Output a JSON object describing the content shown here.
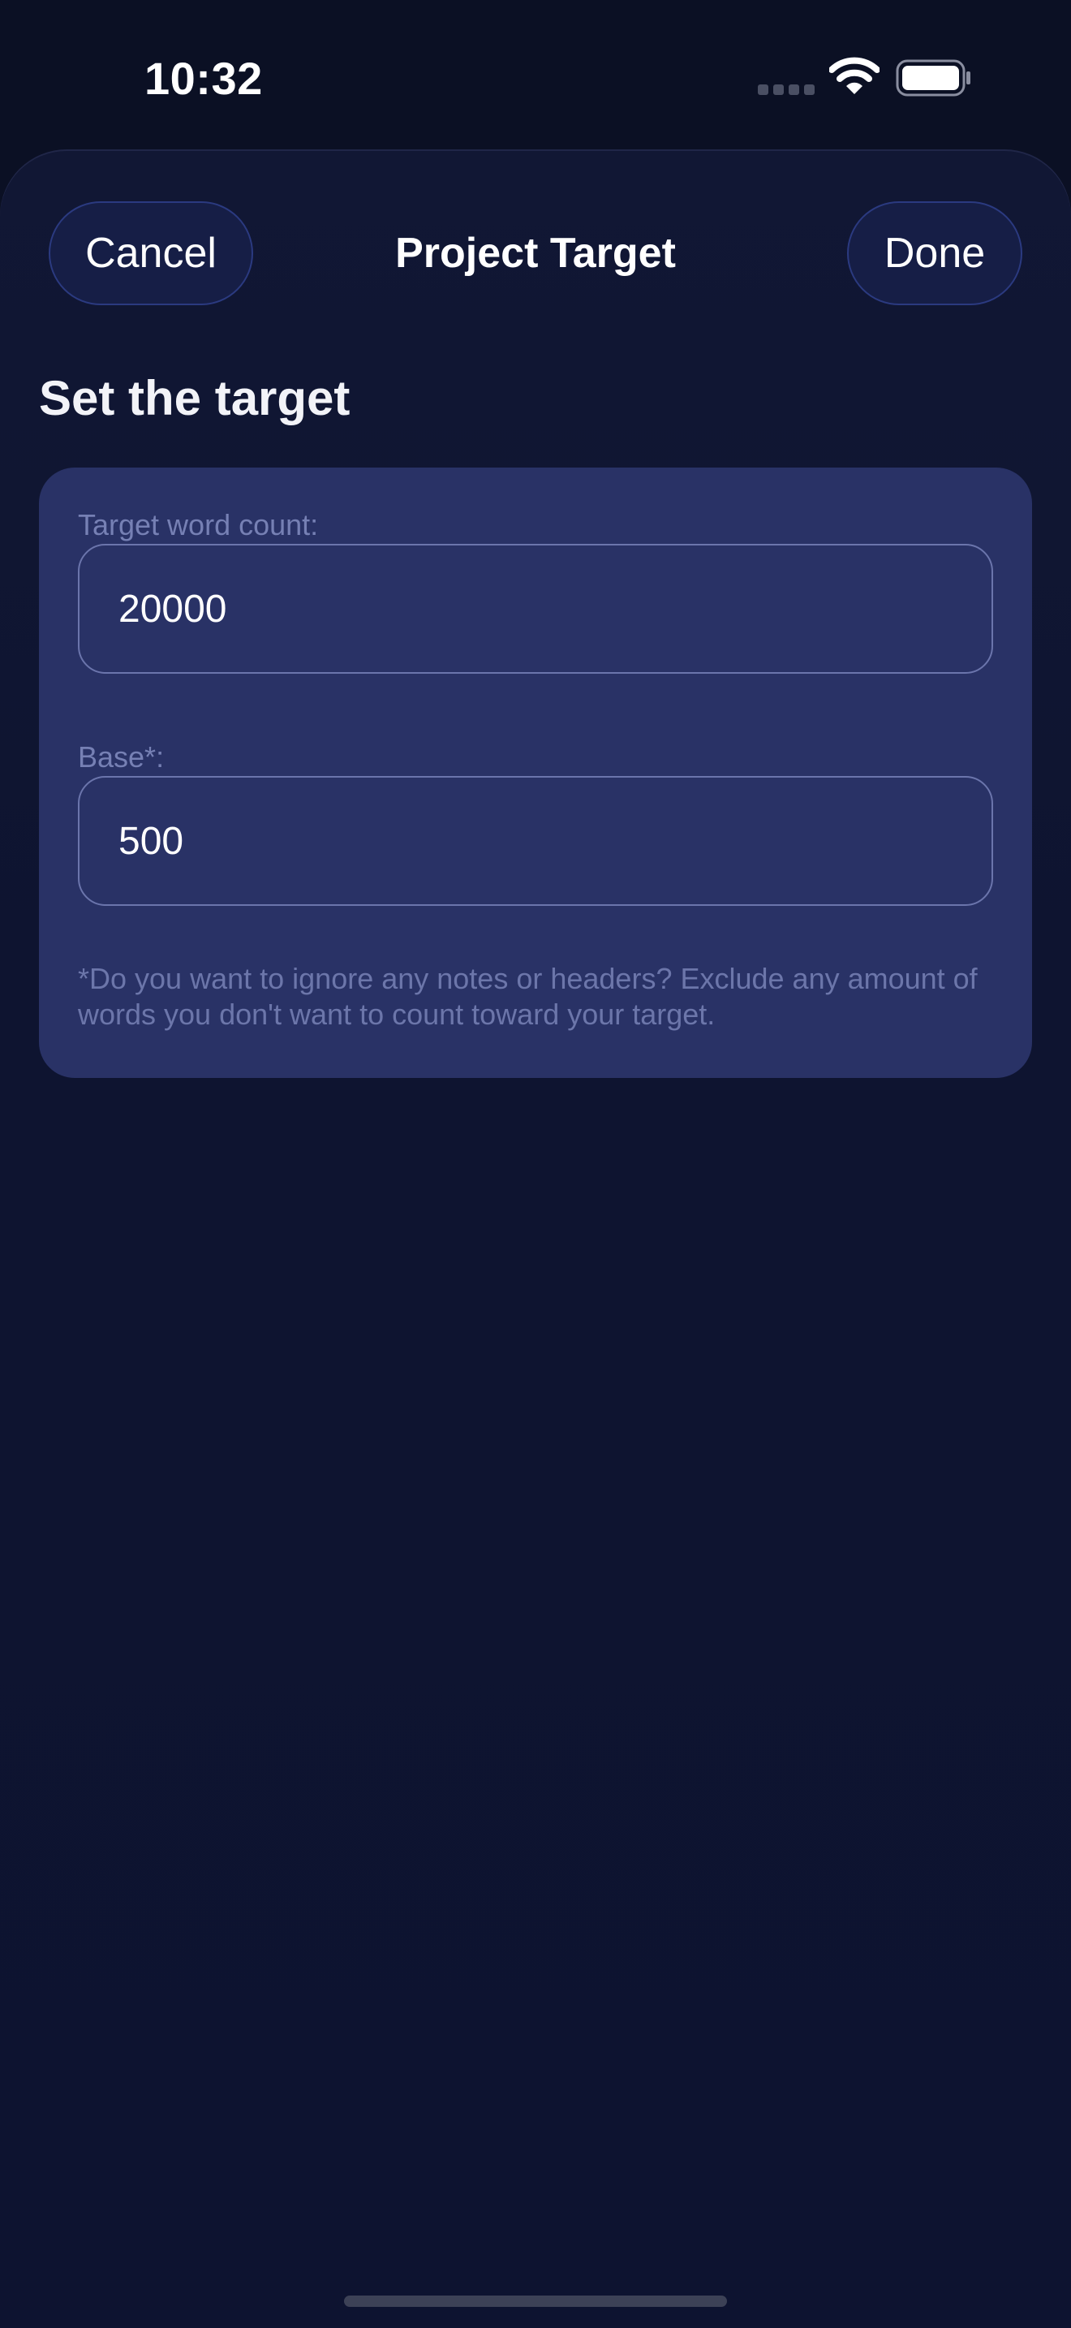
{
  "status_bar": {
    "time": "10:32",
    "icons": [
      "signal-dots-icon",
      "wifi-icon",
      "battery-icon"
    ]
  },
  "nav": {
    "cancel_label": "Cancel",
    "title": "Project Target",
    "done_label": "Done"
  },
  "section": {
    "title": "Set the target"
  },
  "form": {
    "target_label": "Target word count:",
    "target_value": "20000",
    "base_label": "Base*:",
    "base_value": "500",
    "hint": "*Do you want to ignore any notes or headers? Exclude any amount of words you don't want to count toward your target."
  },
  "colors": {
    "background": "#0b1024",
    "card": "#293266",
    "button": "#161e46",
    "button_border": "#2b3a80",
    "label": "#7680b4"
  }
}
